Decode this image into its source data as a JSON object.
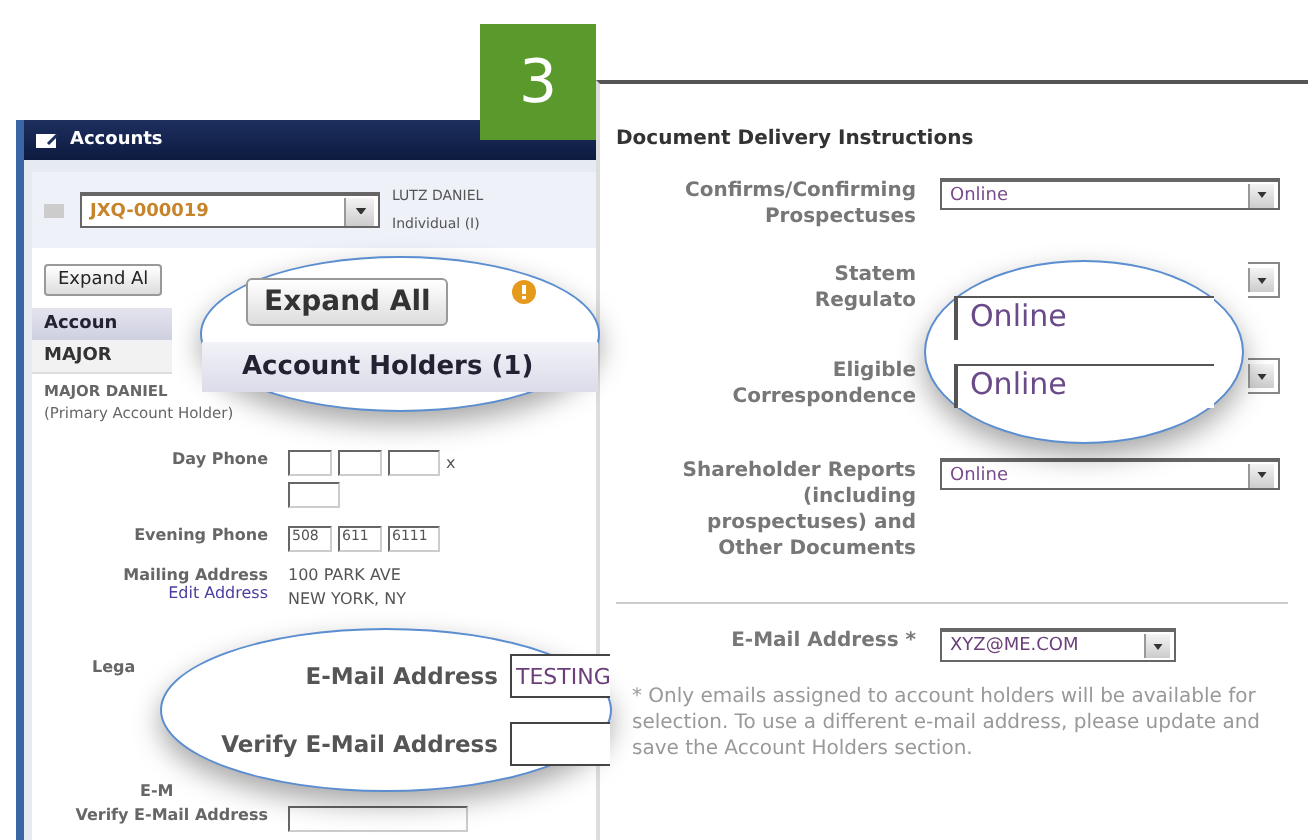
{
  "badge": "3",
  "accounts_window": {
    "title": "Accounts",
    "account_select": "JXQ-000019",
    "holder_name": "LUTZ DANIEL",
    "holder_type": "Individual (I)",
    "expand_button": "Expand Al",
    "section_header": "Accoun",
    "holder_row": "MAJOR",
    "holder_detail": "MAJOR DANIEL",
    "holder_role": "(Primary Account Holder)",
    "day_phone": {
      "label": "Day Phone",
      "extension_mark": "x"
    },
    "evening_phone": {
      "label": "Evening Phone",
      "values": [
        "508",
        "611",
        "6111"
      ]
    },
    "mailing": {
      "label": "Mailing Address",
      "link": "Edit Address",
      "lines": [
        "100 PARK AVE",
        "NEW YORK, NY"
      ]
    },
    "partial_labels": [
      "Lega",
      "E-M"
    ],
    "verify_email": {
      "label": "Verify E-Mail Address"
    }
  },
  "callout_top": {
    "button": "Expand All",
    "header": "Account Holders (1)"
  },
  "callout_bottom": {
    "fields": [
      {
        "label": "E-Mail Address",
        "value": "TESTING"
      },
      {
        "label": "Verify E-Mail Address"
      }
    ]
  },
  "delivery": {
    "title": "Document Delivery Instructions",
    "rows": [
      {
        "lines": [
          "Confirms/Confirming",
          "Prospectuses"
        ],
        "value": "Online"
      },
      {
        "lines": [
          "Statem",
          "Regulato"
        ]
      },
      {
        "lines": [
          "Eligible",
          "Correspondence"
        ]
      },
      {
        "lines": [
          "Shareholder Reports",
          "(including",
          "prospectuses) and",
          "Other Documents"
        ],
        "value": "Online"
      }
    ],
    "email": {
      "label": "E-Mail Address *",
      "value": "XYZ@ME.COM"
    },
    "note": "* Only emails assigned to account holders will be available for selection. To use a different e-mail address, please update and save the Account Holders section."
  },
  "callout_right": {
    "values": [
      "Online",
      "Online"
    ]
  }
}
